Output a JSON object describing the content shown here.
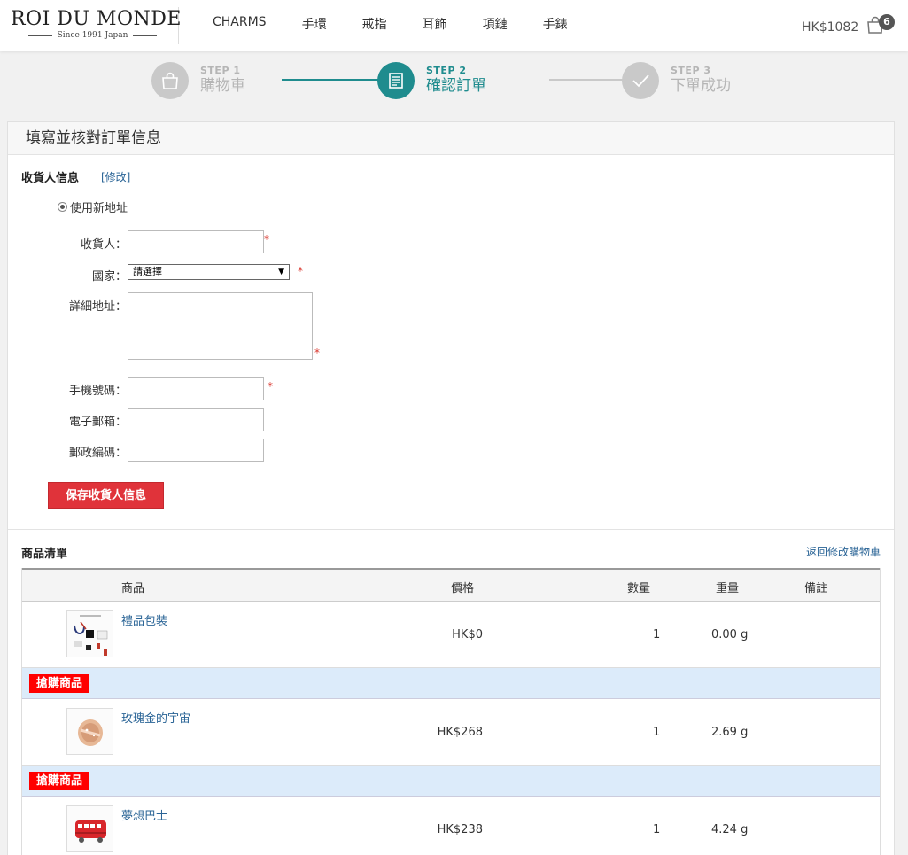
{
  "brand": {
    "name": "ROI DU MONDE",
    "tagline": "Since 1991 Japan"
  },
  "nav": [
    "CHARMS",
    "手環",
    "戒指",
    "耳飾",
    "項鏈",
    "手錶"
  ],
  "header": {
    "total": "HK$1082",
    "cart_count": "6"
  },
  "steps": [
    {
      "num": "STEP 1",
      "label": "購物車"
    },
    {
      "num": "STEP 2",
      "label": "確認訂單"
    },
    {
      "num": "STEP 3",
      "label": "下單成功"
    }
  ],
  "panel_title": "填寫並核對訂單信息",
  "consignee": {
    "title": "收貨人信息",
    "edit": "[修改]",
    "use_new": "使用新地址",
    "labels": {
      "name": "收貨人：",
      "country": "國家：",
      "address": "詳細地址：",
      "mobile": "手機號碼：",
      "email": "電子郵箱：",
      "postcode": "郵政編碼："
    },
    "country_selected": "請選擇",
    "required_mark": "*",
    "save_button": "保存收貨人信息"
  },
  "order": {
    "title": "商品清單",
    "back_link": "返回修改購物車",
    "columns": [
      "商品",
      "價格",
      "數量",
      "重量",
      "備註"
    ],
    "promo_label": "搶購商品",
    "items": [
      {
        "name": "禮品包裝",
        "price": "HK$0",
        "qty": "1",
        "weight": "0.00 g",
        "icon": "gift-package-thumbnail"
      },
      {
        "name": "玫瑰金的宇宙",
        "price": "HK$268",
        "qty": "1",
        "weight": "2.69 g",
        "icon": "rose-gold-charm-thumbnail"
      },
      {
        "name": "夢想巴士",
        "price": "HK$238",
        "qty": "1",
        "weight": "4.24 g",
        "icon": "red-bus-charm-thumbnail"
      }
    ]
  },
  "colors": {
    "accent": "#1f8c8e",
    "button": "#e0333a",
    "promo": "#ff0000",
    "promo_row": "#dcebfa",
    "link": "#2a6496"
  }
}
